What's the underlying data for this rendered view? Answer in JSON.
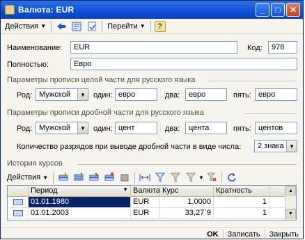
{
  "window": {
    "title": "Валюта: EUR"
  },
  "toolbar": {
    "actions_label": "Действия",
    "goto_label": "Перейти",
    "help_label": "?"
  },
  "form": {
    "name_label": "Наименование:",
    "name_value": "EUR",
    "code_label": "Код:",
    "code_value": "978",
    "full_label": "Полностью:",
    "full_value": "Евро"
  },
  "integer_section": {
    "title": "Параметры прописи целой части для русского языка",
    "gender_label": "Род:",
    "gender_value": "Мужской",
    "one_label": "один:",
    "one_value": "евро",
    "two_label": "два:",
    "two_value": "евро",
    "five_label": "пять:",
    "five_value": "евро"
  },
  "fraction_section": {
    "title": "Параметры прописи дробной части для русского языка",
    "gender_label": "Род:",
    "gender_value": "Мужской",
    "one_label": "один:",
    "one_value": "цент",
    "two_label": "два:",
    "two_value": "цента",
    "five_label": "пять:",
    "five_value": "центов",
    "digits_label": "Количество разрядов при выводе дробной части в виде числа:",
    "digits_value": "2 знака"
  },
  "history": {
    "title": "История курсов",
    "actions_label": "Действия",
    "columns": [
      "Период",
      "Валюта",
      "Курс",
      "Кратность"
    ],
    "rows": [
      {
        "period": "01.01.1980",
        "currency": "EUR",
        "rate": "1,0000",
        "multiplicity": "1"
      },
      {
        "period": "01.01.2003",
        "currency": "EUR",
        "rate": "33,27`9",
        "multiplicity": "1"
      }
    ]
  },
  "footer": {
    "ok_label": "OK",
    "save_label": "Записать",
    "close_label": "Закрыть"
  },
  "colors": {
    "titlebar": "#0f4fd6",
    "selection": "#0a246a",
    "background": "#f5f4ee"
  }
}
